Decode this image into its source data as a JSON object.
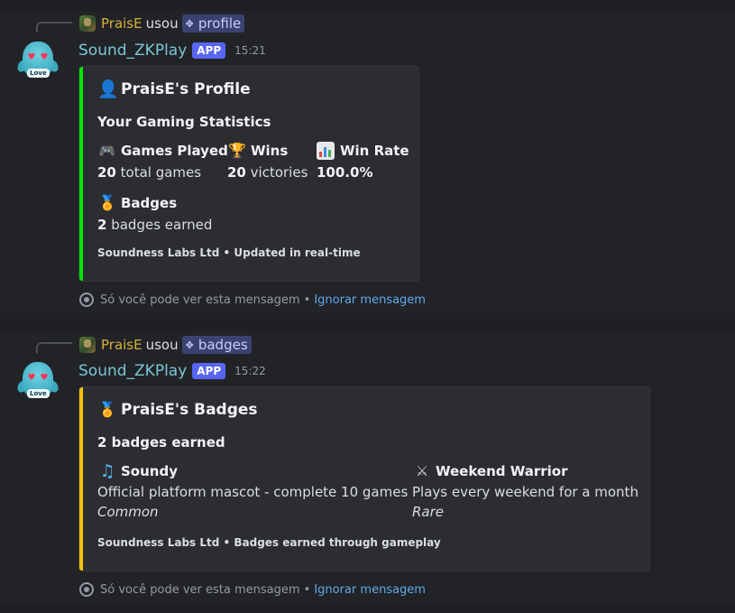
{
  "messages": [
    {
      "reply": {
        "user": "PraisE",
        "uses_text": "usou",
        "command": "profile",
        "command_icon": "slash-command-icon"
      },
      "author": {
        "name": "Sound_ZKPlay",
        "badge": "APP",
        "time": "15:21",
        "avatar_label": "Love"
      },
      "embed": {
        "accent_color": "#00e600",
        "title": "PraisE's Profile",
        "title_icon": "person-icon",
        "description": "Your Gaming Statistics",
        "fields": [
          {
            "name": "Games Played",
            "icon": "gamepad-icon",
            "value_bold": "20",
            "value_rest": "total games"
          },
          {
            "name": "Wins",
            "icon": "trophy-icon",
            "value_bold": "20",
            "value_rest": "victories"
          },
          {
            "name": "Win Rate",
            "icon": "bar-chart-icon",
            "value_bold": "100.0%",
            "value_rest": ""
          },
          {
            "name": "Badges",
            "icon": "medal-icon",
            "value_bold": "2",
            "value_rest": "badges earned"
          }
        ],
        "footer": "Soundness Labs Ltd • Updated in real-time"
      },
      "ephemeral": {
        "text": "Só você pode ver esta mensagem •",
        "link": "Ignorar mensagem"
      }
    },
    {
      "reply": {
        "user": "PraisE",
        "uses_text": "usou",
        "command": "badges",
        "command_icon": "slash-command-icon"
      },
      "author": {
        "name": "Sound_ZKPlay",
        "badge": "APP",
        "time": "15:22",
        "avatar_label": "Love"
      },
      "embed": {
        "accent_color": "#f5c400",
        "title": "PraisE's Badges",
        "title_icon": "medal-icon",
        "description": "2 badges earned",
        "fields": [
          {
            "name": "Soundy",
            "icon": "music-note-icon",
            "value": "Official platform mascot - complete 10 games",
            "rarity": "Common"
          },
          {
            "name": "Weekend Warrior",
            "icon": "crossed-swords-icon",
            "value": "Plays every weekend for a month",
            "rarity": "Rare"
          }
        ],
        "footer": "Soundness Labs Ltd • Badges earned through gameplay"
      },
      "ephemeral": {
        "text": "Só você pode ver esta mensagem •",
        "link": "Ignorar mensagem"
      }
    }
  ]
}
